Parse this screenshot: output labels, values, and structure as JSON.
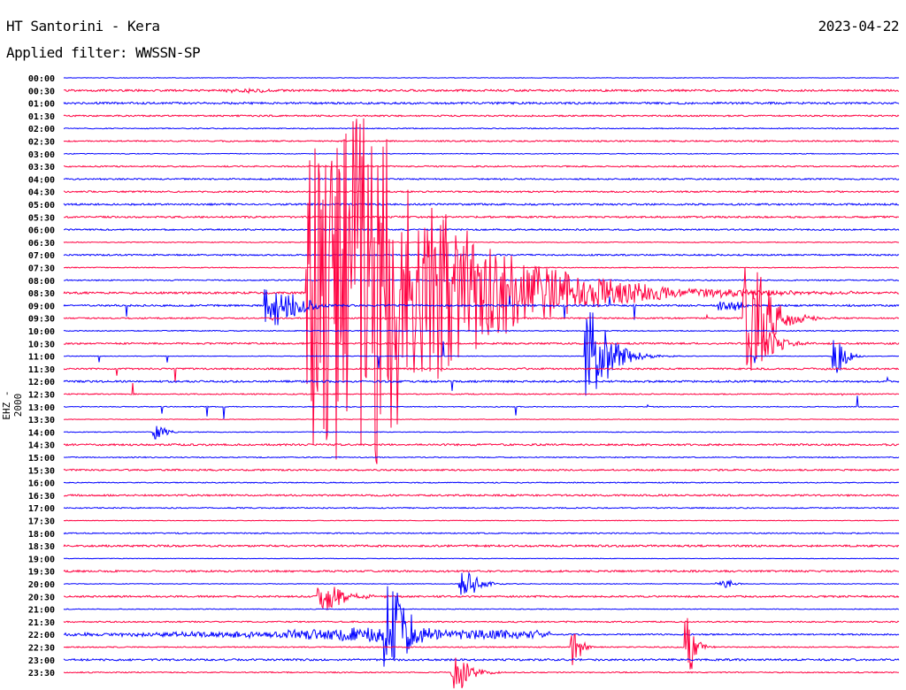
{
  "header": {
    "station": "HT Santorini - Kera",
    "filter": "Applied filter: WWSSN-SP",
    "date": "2023-04-22",
    "channel": "EHZ - 2000"
  },
  "chart_data": {
    "type": "line",
    "title": "HT Santorini - Kera",
    "subtitle": "Applied filter: WWSSN-SP",
    "ylabel": "EHZ - 2000",
    "row_minutes": 30,
    "colors": [
      "#0000ff",
      "#ff0040"
    ],
    "row_labels": [
      "00:00",
      "00:30",
      "01:00",
      "01:30",
      "02:00",
      "02:30",
      "03:00",
      "03:30",
      "04:00",
      "04:30",
      "05:00",
      "05:30",
      "06:00",
      "06:30",
      "07:00",
      "07:30",
      "08:00",
      "08:30",
      "09:00",
      "09:30",
      "10:00",
      "10:30",
      "11:00",
      "11:30",
      "12:00",
      "12:30",
      "13:00",
      "13:30",
      "14:00",
      "14:30",
      "15:00",
      "15:30",
      "16:00",
      "16:30",
      "17:00",
      "17:30",
      "18:00",
      "18:30",
      "19:00",
      "19:30",
      "20:00",
      "20:30",
      "21:00",
      "21:30",
      "22:00",
      "22:30",
      "23:00",
      "23:30"
    ],
    "events": [
      {
        "row": 1,
        "minute": 5.8,
        "amp": 0.15,
        "dur": 1.5
      },
      {
        "row": 17,
        "minute": 8.7,
        "amp": 14,
        "dur": 2.5,
        "coda": 8
      },
      {
        "row": 18,
        "minute": 7.2,
        "amp": 1.6,
        "dur": 0.8,
        "coda": 1.5
      },
      {
        "row": 18,
        "minute": 23.5,
        "amp": 0.4,
        "dur": 0.8
      },
      {
        "row": 19,
        "minute": 24.4,
        "amp": 4.5,
        "dur": 0.5,
        "coda": 1.5
      },
      {
        "row": 21,
        "minute": 25.1,
        "amp": 1.0,
        "dur": 0.4,
        "coda": 1
      },
      {
        "row": 22,
        "minute": 18.7,
        "amp": 3.5,
        "dur": 0.5,
        "coda": 1.5
      },
      {
        "row": 22,
        "minute": 27.6,
        "amp": 1.4,
        "dur": 0.3,
        "coda": 0.6
      },
      {
        "row": 28,
        "minute": 3.2,
        "amp": 0.7,
        "dur": 0.3,
        "coda": 0.5
      },
      {
        "row": 40,
        "minute": 14.2,
        "amp": 1.0,
        "dur": 0.4,
        "coda": 1
      },
      {
        "row": 40,
        "minute": 23.4,
        "amp": 0.3,
        "dur": 0.5
      },
      {
        "row": 41,
        "minute": 9.1,
        "amp": 1.2,
        "dur": 0.4,
        "coda": 1.5
      },
      {
        "row": 44,
        "minute": 11.5,
        "amp": 3.5,
        "dur": 0.6,
        "coda": 1
      },
      {
        "row": 45,
        "minute": 18.2,
        "amp": 1.6,
        "dur": 0.2,
        "coda": 0.5
      },
      {
        "row": 45,
        "minute": 22.3,
        "amp": 2.6,
        "dur": 0.2,
        "coda": 0.5
      },
      {
        "row": 47,
        "minute": 13.9,
        "amp": 1.6,
        "dur": 0.4,
        "coda": 1
      }
    ]
  }
}
